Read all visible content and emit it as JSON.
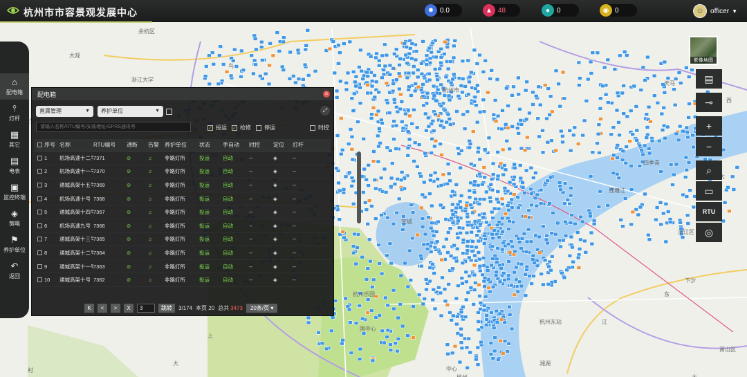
{
  "header": {
    "title": "杭州市市容景观发展中心",
    "stats": [
      {
        "icon": "sun-icon",
        "value": "0.0",
        "color": "#3f6fd8"
      },
      {
        "icon": "bell-icon",
        "value": "48",
        "color": "#d9315b"
      },
      {
        "icon": "user-icon",
        "value": "0",
        "color": "#1fa6a1"
      },
      {
        "icon": "coin-icon",
        "value": "0",
        "color": "#d7b21c"
      }
    ],
    "user": {
      "name": "officer"
    }
  },
  "sidebar": {
    "items": [
      {
        "label": "配电箱",
        "icon": "home-icon",
        "active": true
      },
      {
        "label": "灯杆",
        "icon": "lamp-pole-icon"
      },
      {
        "label": "其它",
        "icon": "grid-icon"
      },
      {
        "label": "电表",
        "icon": "meter-icon"
      },
      {
        "label": "监控终端",
        "icon": "monitor-icon"
      },
      {
        "label": "策略",
        "icon": "layers-icon"
      },
      {
        "label": "养护单位",
        "icon": "flag-icon"
      },
      {
        "label": "返回",
        "icon": "back-arrow-icon"
      }
    ]
  },
  "map": {
    "satellite_label": "影像地图",
    "rtu_label": "RTU",
    "labels": [
      "大观",
      "大学城",
      "浙江大学",
      "浙江大学",
      "杭州市",
      "钱塘江",
      "滨江区",
      "宋城",
      "天马",
      "鸟",
      "西",
      "大",
      "国中心",
      "杭州乐园",
      "上",
      "中心",
      "下沙",
      "江",
      "四季青",
      "余杭区",
      "东",
      "萧山区",
      "杭州东站",
      "湘湖",
      "大",
      "杭州",
      "村",
      "大"
    ]
  },
  "panel": {
    "title": "配电箱",
    "select_district": "直属管理",
    "select_unit": "养护单位",
    "search_placeholder": "请输入名称/RTU编号/安装地址/GPRS通讯号",
    "filters": {
      "online": "投运",
      "repair": "检修",
      "stop": "停运",
      "timectl": "时控"
    },
    "columns": {
      "idx": "序号",
      "name": "名称",
      "rtu": "RTU编号",
      "comm": "通断",
      "alarm": "告警",
      "unit": "养护单位",
      "status": "状态",
      "mode": "手自动",
      "time": "时控",
      "pos": "定位",
      "pole": "灯杆"
    },
    "rows": [
      {
        "idx": "1",
        "name": "机场高速十二号",
        "rtu": "7371",
        "unit": "非路灯所",
        "status": "投运",
        "mode": "自动",
        "time": "--",
        "pole": "--"
      },
      {
        "idx": "2",
        "name": "机场高速十一号",
        "rtu": "7370",
        "unit": "非路灯所",
        "status": "投运",
        "mode": "自动",
        "time": "--",
        "pole": "--"
      },
      {
        "idx": "3",
        "name": "通城高架十五号",
        "rtu": "7369",
        "unit": "非路灯所",
        "status": "投运",
        "mode": "自动",
        "time": "--",
        "pole": "--"
      },
      {
        "idx": "4",
        "name": "机场高速十号",
        "rtu": "7368",
        "unit": "非路灯所",
        "status": "投运",
        "mode": "自动",
        "time": "--",
        "pole": "--"
      },
      {
        "idx": "5",
        "name": "通城高架十四号",
        "rtu": "7367",
        "unit": "非路灯所",
        "status": "投运",
        "mode": "自动",
        "time": "--",
        "pole": "--"
      },
      {
        "idx": "6",
        "name": "机场高速九号",
        "rtu": "7366",
        "unit": "非路灯所",
        "status": "投运",
        "mode": "自动",
        "time": "--",
        "pole": "--"
      },
      {
        "idx": "7",
        "name": "通城高架十三号",
        "rtu": "7365",
        "unit": "非路灯所",
        "status": "投运",
        "mode": "自动",
        "time": "--",
        "pole": "--"
      },
      {
        "idx": "8",
        "name": "通城高架十二号",
        "rtu": "7364",
        "unit": "非路灯所",
        "status": "投运",
        "mode": "自动",
        "time": "--",
        "pole": "--"
      },
      {
        "idx": "9",
        "name": "通城高架十一号",
        "rtu": "7363",
        "unit": "非路灯所",
        "status": "投运",
        "mode": "自动",
        "time": "--",
        "pole": "--"
      },
      {
        "idx": "10",
        "name": "通城高架十号",
        "rtu": "7362",
        "unit": "非路灯所",
        "status": "投运",
        "mode": "自动",
        "time": "--",
        "pole": "--"
      }
    ],
    "pager": {
      "first": "K",
      "prev": "<",
      "next": ">",
      "last": "X",
      "page": "3",
      "jump": "跳转",
      "page_of": "3/174",
      "this_page": "本页 20",
      "total_label": "总共",
      "total": "3473",
      "per_page": "20条/页"
    }
  }
}
